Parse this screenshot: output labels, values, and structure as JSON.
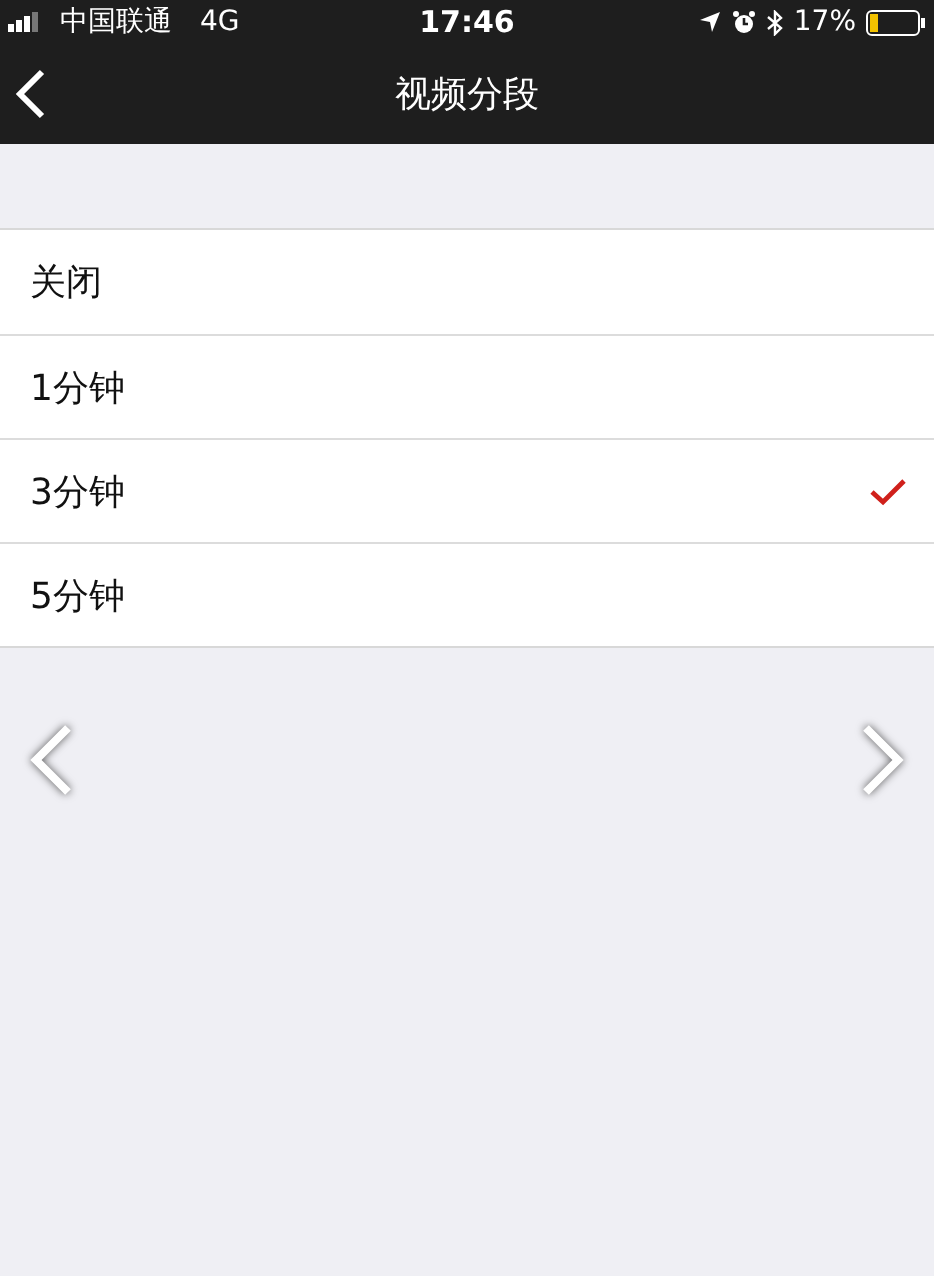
{
  "status_bar": {
    "carrier": "中国联通",
    "network": "4G",
    "time": "17:46",
    "battery": "17%"
  },
  "nav_bar": {
    "title": "视频分段"
  },
  "options": [
    {
      "label": "关闭",
      "selected": false
    },
    {
      "label": "1分钟",
      "selected": false
    },
    {
      "label": "3分钟",
      "selected": true
    },
    {
      "label": "5分钟",
      "selected": false
    }
  ]
}
